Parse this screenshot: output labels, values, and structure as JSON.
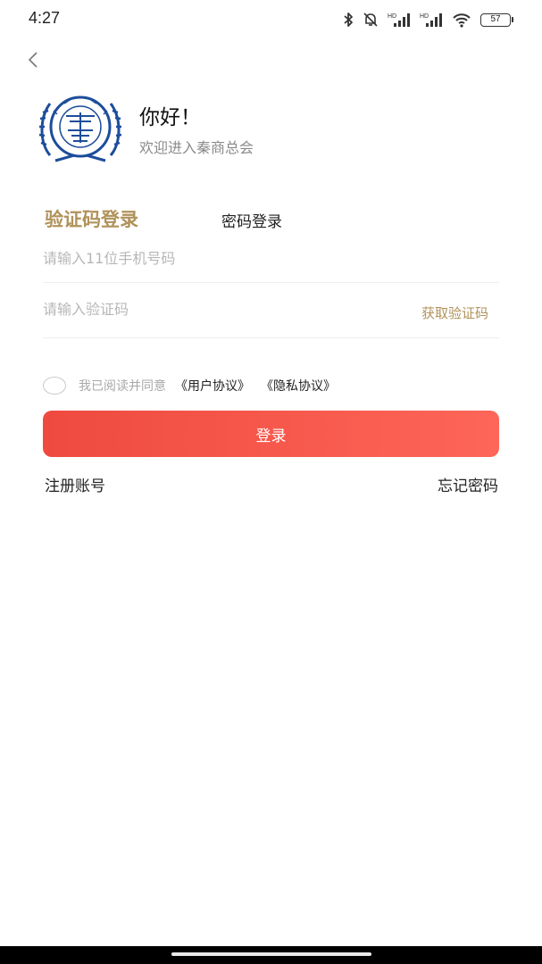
{
  "status_bar": {
    "time": "4:27",
    "battery": "57",
    "icons": [
      "bluetooth-icon",
      "bell-off-icon",
      "signal-icon",
      "signal-icon",
      "wifi-icon",
      "battery-icon"
    ]
  },
  "header": {
    "back_icon": "chevron-left-icon",
    "greeting": "你好！",
    "subtitle": "欢迎进入秦商总会"
  },
  "tabs": [
    {
      "label": "验证码登录",
      "active": true
    },
    {
      "label": "密码登录",
      "active": false
    }
  ],
  "form": {
    "phone_placeholder": "请输入11位手机号码",
    "code_placeholder": "请输入验证码",
    "get_code_label": "获取验证码"
  },
  "agreement": {
    "prefix": "我已阅读并同意",
    "user_agreement": "《用户协议》",
    "privacy_agreement": "《隐私协议》"
  },
  "login_button": "登录",
  "links": {
    "register": "注册账号",
    "forgot": "忘记密码"
  },
  "colors": {
    "accent": "#b0925a",
    "button_start": "#ef4a3f",
    "button_end": "#fd6658",
    "logo_blue": "#1d4d9b"
  }
}
